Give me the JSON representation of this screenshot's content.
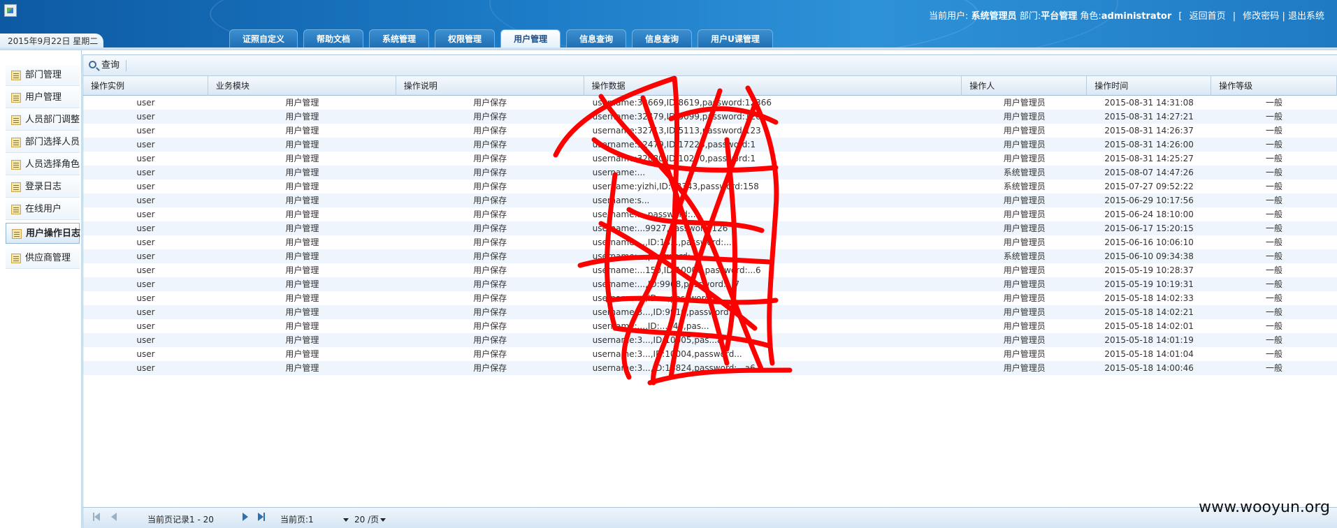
{
  "header": {
    "current_user_label": "当前用户:",
    "current_user": "系统管理员",
    "dept_label": "部门:",
    "dept": "平台管理",
    "role_label": "角色:",
    "role": "administrator",
    "links": [
      "返回首页",
      "修改密码",
      "退出系统"
    ],
    "date": "2015年9月22日 星期二"
  },
  "tabs": [
    {
      "label": "证照自定义",
      "active": false
    },
    {
      "label": "帮助文档",
      "active": false
    },
    {
      "label": "系统管理",
      "active": false
    },
    {
      "label": "权限管理",
      "active": false
    },
    {
      "label": "用户管理",
      "active": true
    },
    {
      "label": "信息查询",
      "active": false
    },
    {
      "label": "信息查询",
      "active": false
    },
    {
      "label": "用户U课管理",
      "active": false
    }
  ],
  "sidebar": {
    "items": [
      {
        "label": "部门管理",
        "active": false
      },
      {
        "label": "用户管理",
        "active": false
      },
      {
        "label": "人员部门调整",
        "active": false
      },
      {
        "label": "部门选择人员",
        "active": false
      },
      {
        "label": "人员选择角色",
        "active": false
      },
      {
        "label": "登录日志",
        "active": false
      },
      {
        "label": "在线用户",
        "active": false
      },
      {
        "label": "用户操作日志",
        "active": true
      },
      {
        "label": "供应商管理",
        "active": false
      }
    ]
  },
  "toolbar": {
    "query_label": "查询"
  },
  "table": {
    "columns": [
      "操作实例",
      "业务模块",
      "操作说明",
      "操作数据",
      "操作人",
      "操作时间",
      "操作等级"
    ],
    "rows": [
      [
        "user",
        "用户管理",
        "用户保存",
        "username:32669,ID:8619,password:12366",
        "用户管理员",
        "2015-08-31 14:31:08",
        "一般"
      ],
      [
        "user",
        "用户管理",
        "用户保存",
        "username:32479,ID:5099,password:126",
        "用户管理员",
        "2015-08-31 14:27:21",
        "一般"
      ],
      [
        "user",
        "用户管理",
        "用户保存",
        "username:32713,ID:5113,password:123",
        "用户管理员",
        "2015-08-31 14:26:37",
        "一般"
      ],
      [
        "user",
        "用户管理",
        "用户保存",
        "username:32479,ID:17228,password:1",
        "用户管理员",
        "2015-08-31 14:26:00",
        "一般"
      ],
      [
        "user",
        "用户管理",
        "用户保存",
        "username:32080,ID:10270,password:1",
        "用户管理员",
        "2015-08-31 14:25:27",
        "一般"
      ],
      [
        "user",
        "用户管理",
        "用户保存",
        "username:...",
        "系统管理员",
        "2015-08-07 14:47:26",
        "一般"
      ],
      [
        "user",
        "用户管理",
        "用户保存",
        "username:yizhi,ID:18343,password:158",
        "系统管理员",
        "2015-07-27 09:52:22",
        "一般"
      ],
      [
        "user",
        "用户管理",
        "用户保存",
        "username:s...",
        "用户管理员",
        "2015-06-29 10:17:56",
        "一般"
      ],
      [
        "user",
        "用户管理",
        "用户保存",
        "username:...,password:...",
        "用户管理员",
        "2015-06-24 18:10:00",
        "一般"
      ],
      [
        "user",
        "用户管理",
        "用户保存",
        "username:...9927,password:126",
        "用户管理员",
        "2015-06-17 15:20:15",
        "一般"
      ],
      [
        "user",
        "用户管理",
        "用户保存",
        "username:...,ID:18...,password:...",
        "用户管理员",
        "2015-06-16 10:06:10",
        "一般"
      ],
      [
        "user",
        "用户管理",
        "用户保存",
        "username:...,password:...",
        "系统管理员",
        "2015-06-10 09:34:38",
        "一般"
      ],
      [
        "user",
        "用户管理",
        "用户保存",
        "username:...150,ID:10006,password:...6",
        "用户管理员",
        "2015-05-19 10:28:37",
        "一般"
      ],
      [
        "user",
        "用户管理",
        "用户保存",
        "username:...,ID:9968,password:...7",
        "用户管理员",
        "2015-05-19 10:19:31",
        "一般"
      ],
      [
        "user",
        "用户管理",
        "用户保存",
        "username:...,ID:...,password:...",
        "用户管理员",
        "2015-05-18 14:02:33",
        "一般"
      ],
      [
        "user",
        "用户管理",
        "用户保存",
        "username:3...,ID:9910,password:...",
        "用户管理员",
        "2015-05-18 14:02:21",
        "一般"
      ],
      [
        "user",
        "用户管理",
        "用户保存",
        "username:...,ID:...348,pas...",
        "用户管理员",
        "2015-05-18 14:02:01",
        "一般"
      ],
      [
        "user",
        "用户管理",
        "用户保存",
        "username:3...,ID:10005,pas...an",
        "用户管理员",
        "2015-05-18 14:01:19",
        "一般"
      ],
      [
        "user",
        "用户管理",
        "用户保存",
        "username:3...,ID:10004,password...",
        "用户管理员",
        "2015-05-18 14:01:04",
        "一般"
      ],
      [
        "user",
        "用户管理",
        "用户保存",
        "username:3...,ID:16824,password:...a6",
        "用户管理员",
        "2015-05-18 14:00:46",
        "一般"
      ]
    ]
  },
  "pager": {
    "records": "当前页记录1 - 20",
    "current_page": "当前页:1",
    "page_size": "20 /页"
  },
  "watermark": "www.wooyun.org"
}
